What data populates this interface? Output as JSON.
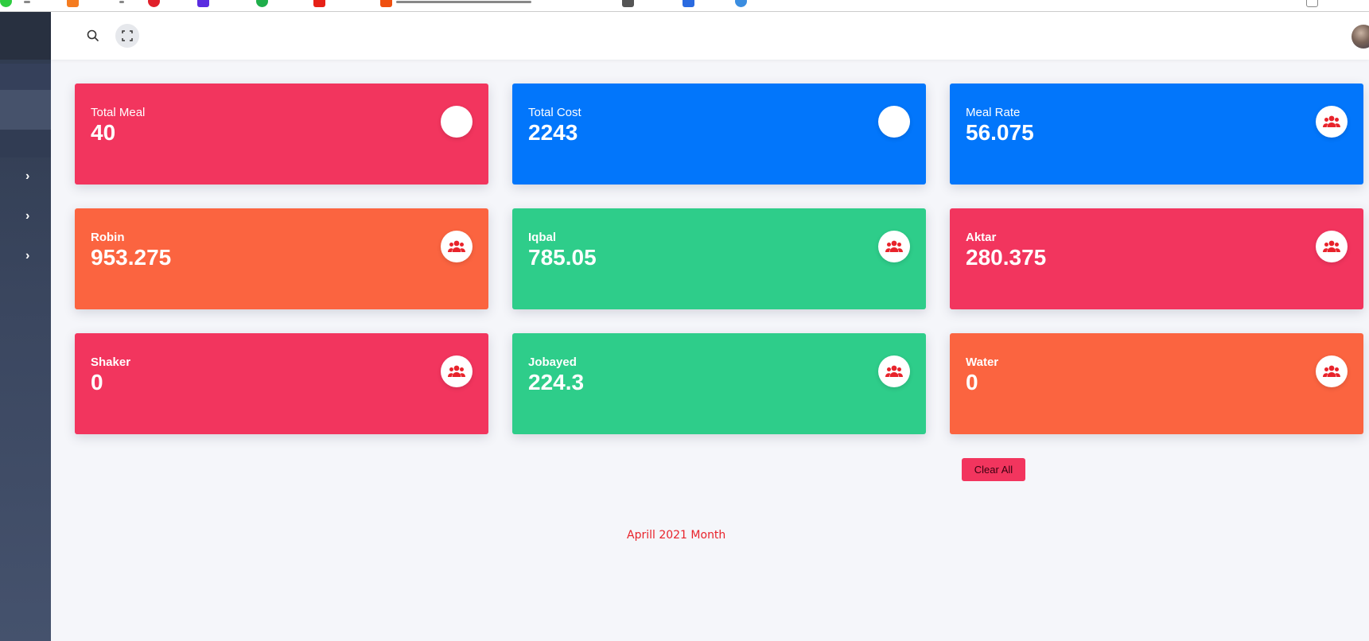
{
  "header": {
    "search_icon": "search-icon",
    "fullscreen_icon": "fullscreen-icon"
  },
  "sidebar": {
    "chevron_icon": "chevron-right-icon",
    "chevrons": [
      "›",
      "›",
      "›"
    ]
  },
  "cards": [
    {
      "label": "Total Meal",
      "value": "40",
      "color": "#f2355e",
      "icon": "circle-icon"
    },
    {
      "label": "Total Cost",
      "value": "2243",
      "color": "#0276fb",
      "icon": "circle-icon"
    },
    {
      "label": "Meal Rate",
      "value": "56.075",
      "color": "#0276fb",
      "icon": "users-icon"
    },
    {
      "label": "Robin",
      "value": "953.275",
      "color": "#fb6440",
      "icon": "users-icon"
    },
    {
      "label": "Iqbal",
      "value": "785.05",
      "color": "#2ecd8a",
      "icon": "users-icon"
    },
    {
      "label": "Aktar",
      "value": "280.375",
      "color": "#f2355e",
      "icon": "users-icon"
    },
    {
      "label": "Shaker",
      "value": "0",
      "color": "#f2355e",
      "icon": "users-icon"
    },
    {
      "label": "Jobayed",
      "value": "224.3",
      "color": "#2ecd8a",
      "icon": "users-icon"
    },
    {
      "label": "Water",
      "value": "0",
      "color": "#fb6440",
      "icon": "users-icon"
    }
  ],
  "actions": {
    "clear_all": "Clear All"
  },
  "footer": {
    "month": "Aprill 2021 Month"
  },
  "colors": {
    "accent_red": "#f2355e",
    "accent_blue": "#0276fb",
    "accent_orange": "#fb6440",
    "accent_green": "#2ecd8a",
    "month_text": "#e8232b",
    "icon_red": "#e8232b"
  }
}
